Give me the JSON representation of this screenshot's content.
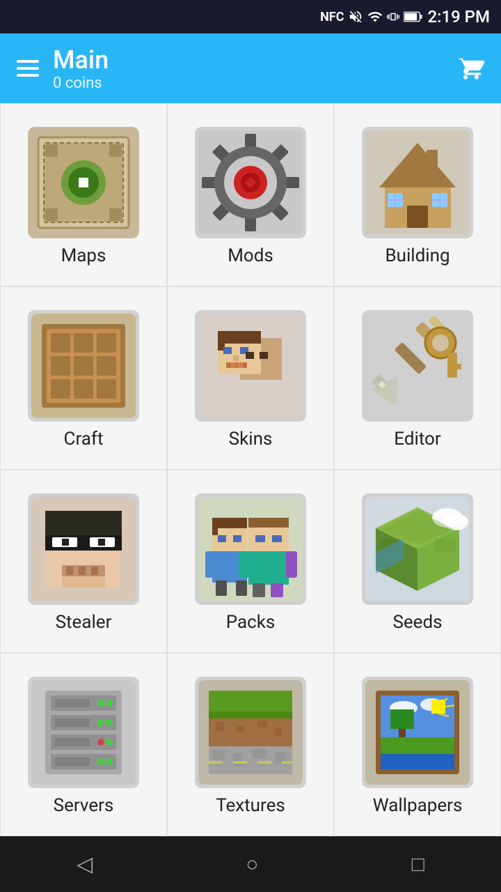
{
  "statusBar": {
    "time": "2:19 PM",
    "icons": [
      "NFC",
      "mute",
      "wifi",
      "vibrate",
      "battery"
    ]
  },
  "header": {
    "title": "Main",
    "subtitle": "0 coins",
    "menuLabel": "Menu",
    "cartLabel": "Cart"
  },
  "grid": {
    "items": [
      {
        "id": "maps",
        "label": "Maps"
      },
      {
        "id": "mods",
        "label": "Mods"
      },
      {
        "id": "building",
        "label": "Building"
      },
      {
        "id": "craft",
        "label": "Craft"
      },
      {
        "id": "skins",
        "label": "Skins"
      },
      {
        "id": "editor",
        "label": "Editor"
      },
      {
        "id": "stealer",
        "label": "Stealer"
      },
      {
        "id": "packs",
        "label": "Packs"
      },
      {
        "id": "seeds",
        "label": "Seeds"
      },
      {
        "id": "servers",
        "label": "Servers"
      },
      {
        "id": "textures",
        "label": "Textures"
      },
      {
        "id": "wallpapers",
        "label": "Wallpapers"
      }
    ]
  },
  "bottomNav": {
    "back": "◁",
    "home": "○",
    "recent": "□"
  }
}
